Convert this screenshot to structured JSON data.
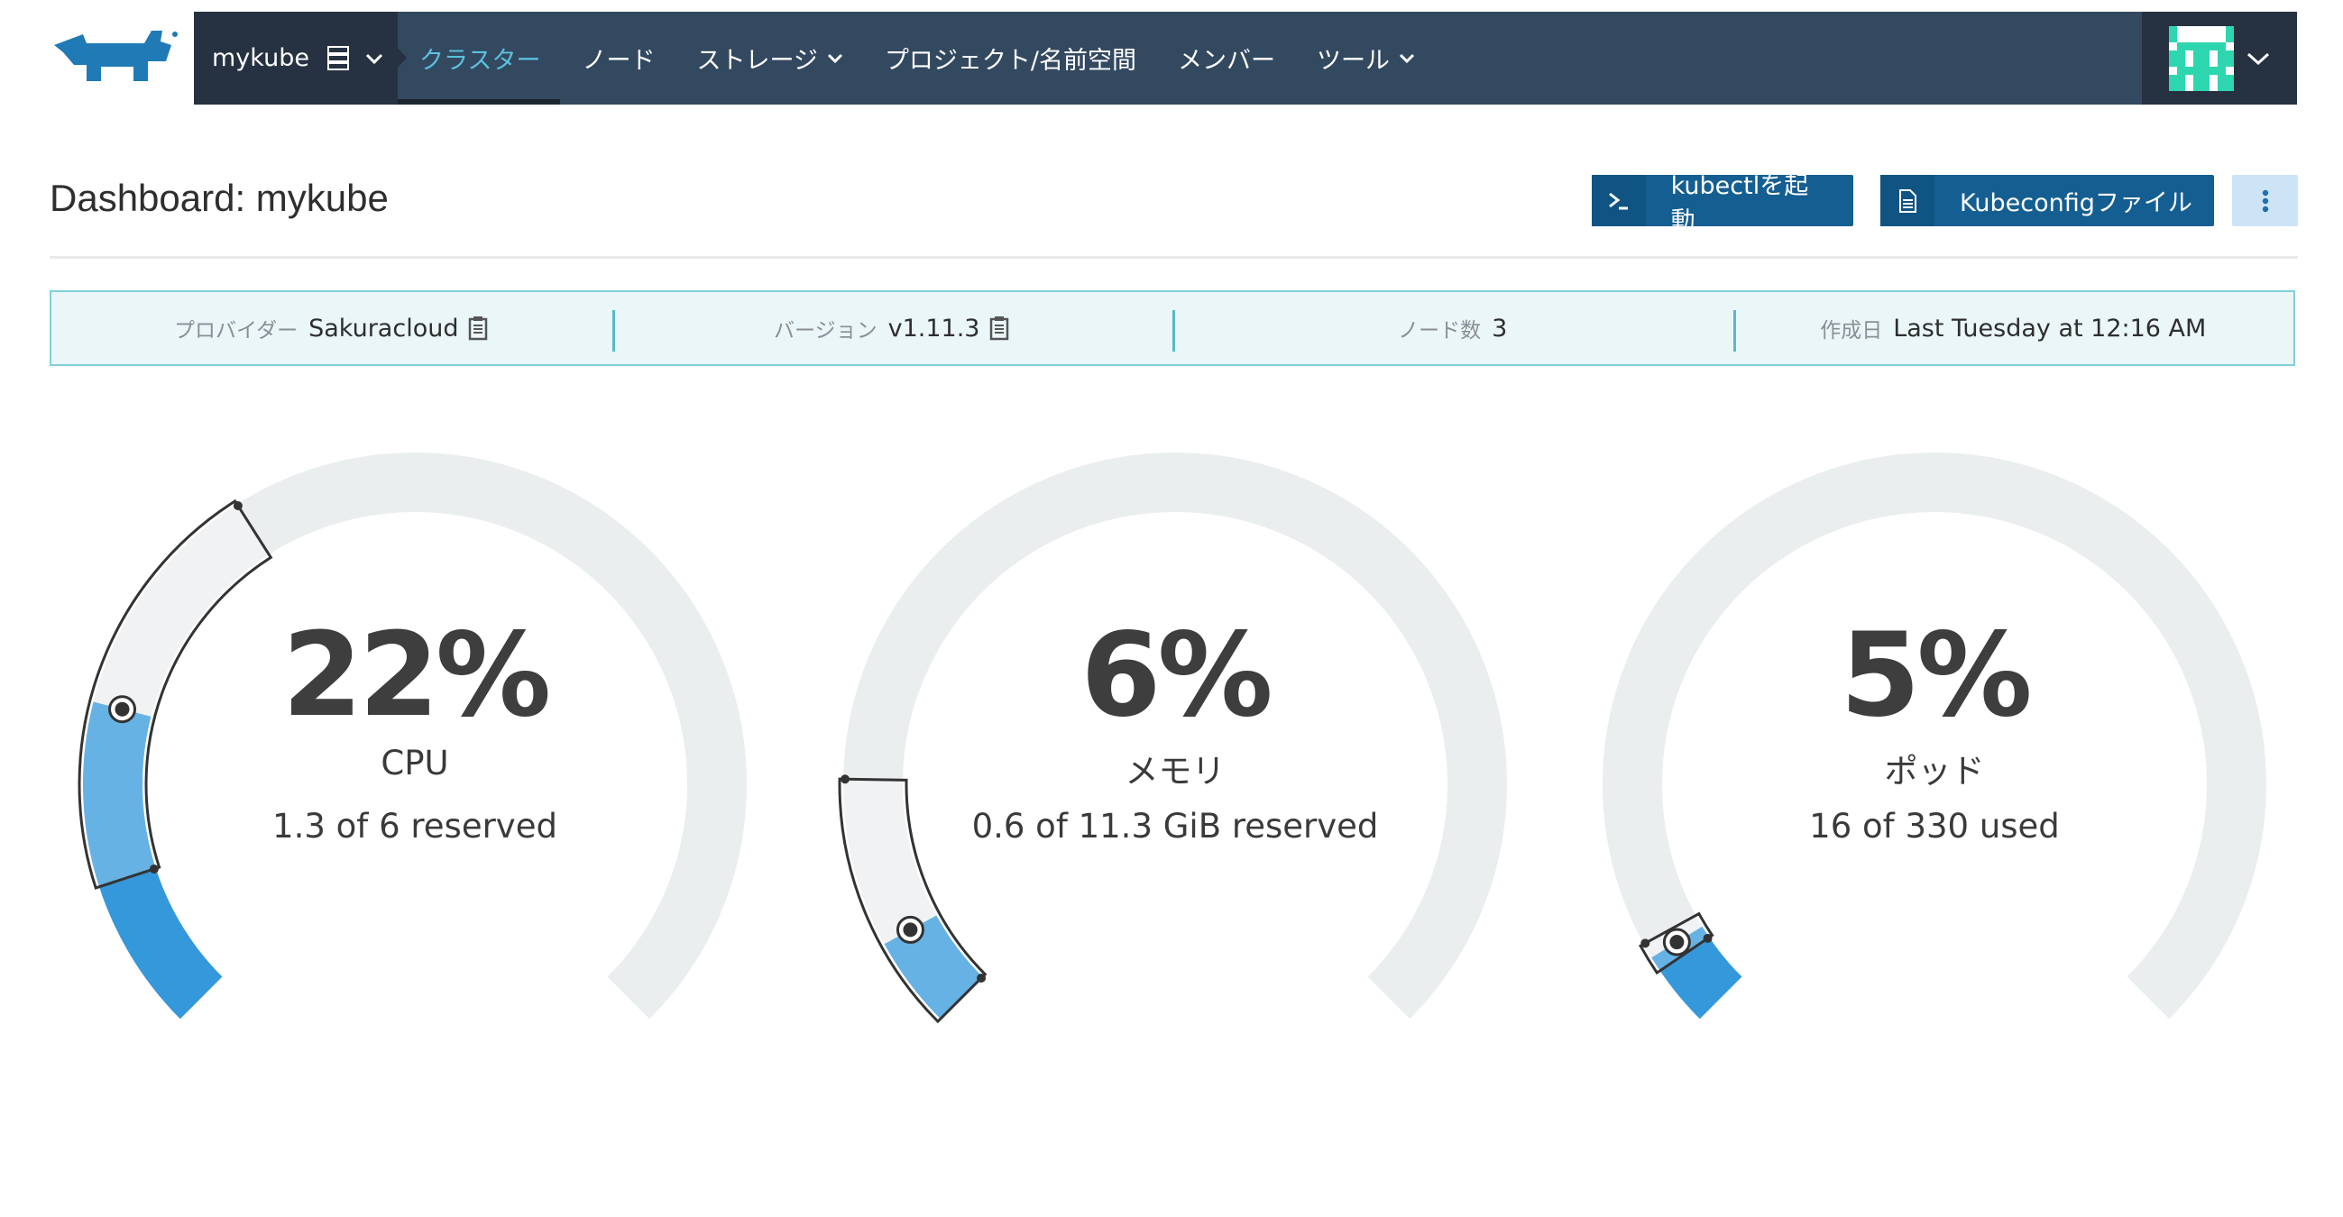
{
  "header": {
    "cluster_name": "mykube",
    "nav": [
      {
        "label": "クラスター",
        "active": true,
        "dropdown": false
      },
      {
        "label": "ノード",
        "active": false,
        "dropdown": false
      },
      {
        "label": "ストレージ",
        "active": false,
        "dropdown": true
      },
      {
        "label": "プロジェクト/名前空間",
        "active": false,
        "dropdown": false
      },
      {
        "label": "メンバー",
        "active": false,
        "dropdown": false
      },
      {
        "label": "ツール",
        "active": false,
        "dropdown": true
      }
    ],
    "icons": {
      "logo": "rancher-logo-icon",
      "server": "server-icon",
      "avatar": "user-avatar-icon"
    }
  },
  "page": {
    "title": "Dashboard: mykube",
    "buttons": {
      "kubectl": "kubectlを起動",
      "kubeconfig": "Kubeconfigファイル"
    }
  },
  "info": {
    "provider_label": "プロバイダー",
    "provider_value": "Sakuracloud",
    "version_label": "バージョン",
    "version_value": "v1.11.3",
    "nodes_label": "ノード数",
    "nodes_value": "3",
    "created_label": "作成日",
    "created_value": "Last Tuesday at 12:16 AM"
  },
  "gauges": [
    {
      "percent": "22%",
      "title": "CPU",
      "subtitle": "1.3 of 6 reserved",
      "fill": 0.22,
      "live_range": [
        0.1,
        0.38
      ],
      "marker": 0.22
    },
    {
      "percent": "6%",
      "title": "メモリ",
      "subtitle": "0.6 of 11.3 GiB reserved",
      "fill": 0.06,
      "live_range": [
        0.0,
        0.17
      ],
      "marker": 0.06
    },
    {
      "percent": "5%",
      "title": "ポッド",
      "subtitle": "16 of 330 used",
      "fill": 0.05,
      "live_range": [
        0.04,
        0.06
      ],
      "marker": 0.05
    }
  ],
  "colors": {
    "nav_bg": "#334960",
    "nav_dark": "#263241",
    "accent": "#5bc0de",
    "primary": "#155e91",
    "gauge_fill": "#3498db",
    "gauge_track": "#ebeeef"
  }
}
